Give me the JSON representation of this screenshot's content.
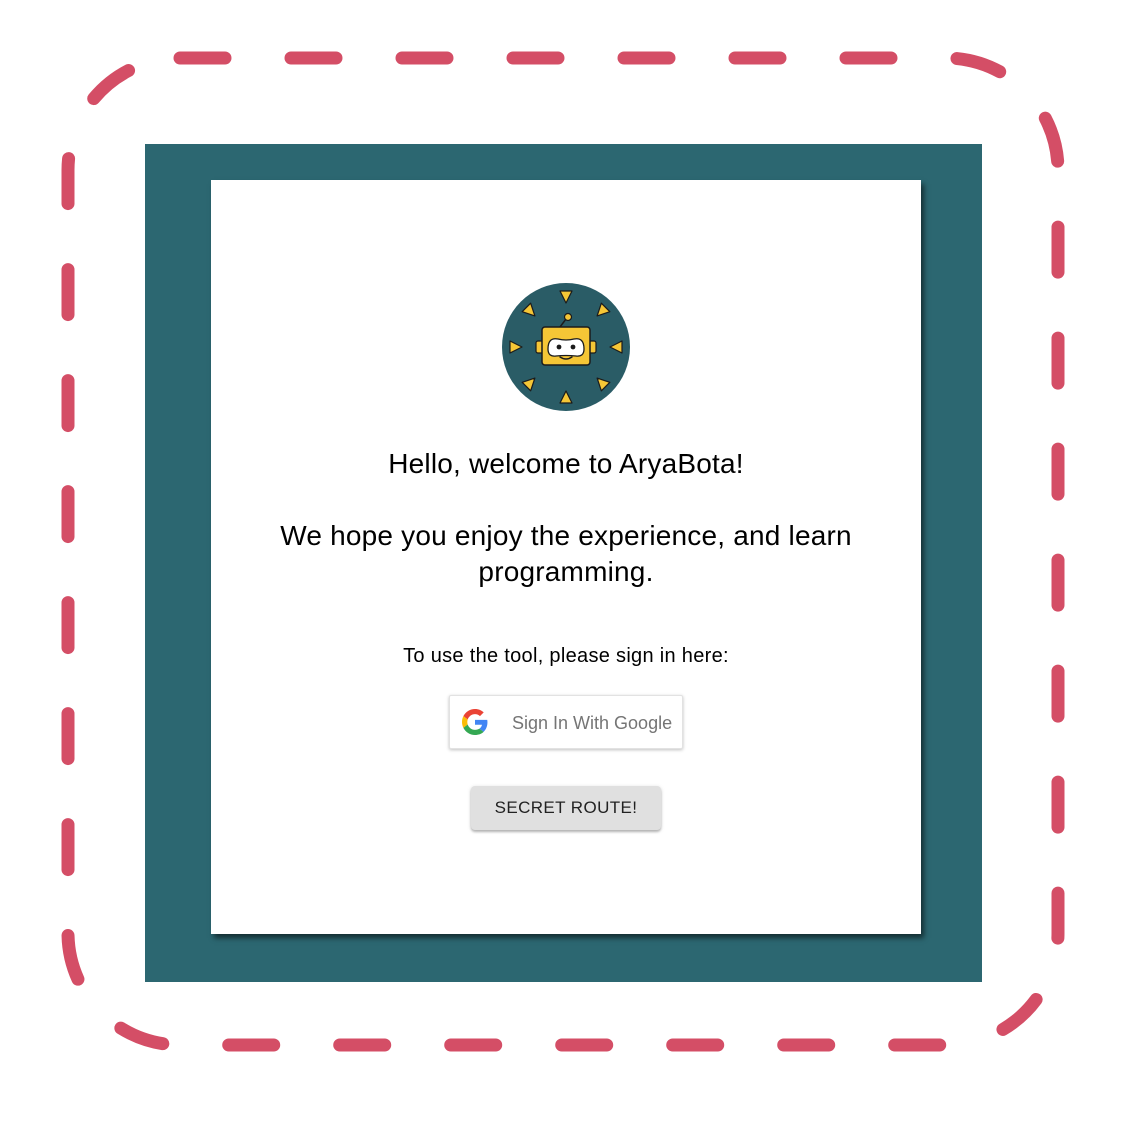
{
  "colors": {
    "frame_dash": "#d44e66",
    "app_background": "#2c6771",
    "card_background": "#ffffff",
    "logo_circle": "#2a5c66",
    "logo_accent": "#f5c636",
    "secret_button_bg": "#e0e0e0"
  },
  "logo": {
    "icon": "aryabota-robot-logo"
  },
  "welcome": {
    "title": "Hello, welcome to AryaBota!",
    "message": "We hope you enjoy the experience, and learn programming.",
    "signin_prompt": "To use the tool, please sign in here:"
  },
  "google_button": {
    "label": "Sign In With Google",
    "icon": "google-g-icon"
  },
  "secret_button": {
    "label": "SECRET ROUTE!"
  }
}
